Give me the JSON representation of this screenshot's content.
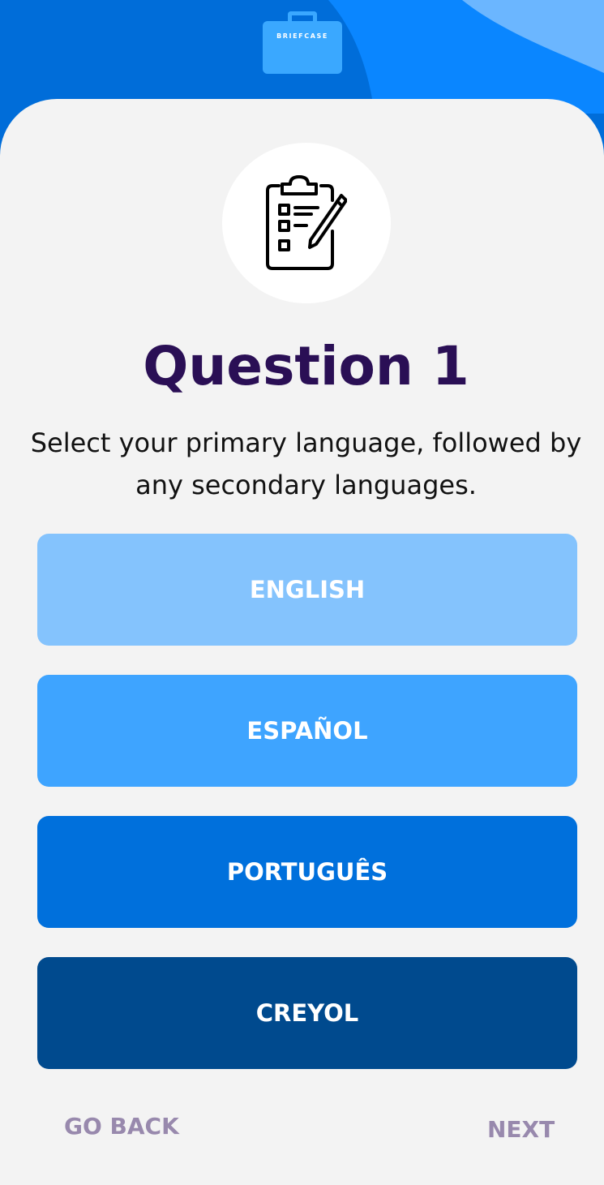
{
  "header": {
    "logo_text": "BRIEFCASE",
    "colors": {
      "dark_blue": "#006dd9",
      "mid_blue": "#0a86ff",
      "light_blue": "#6bb6ff"
    }
  },
  "icon": "clipboard-checklist-icon",
  "title": "Question 1",
  "subtitle": "Select your primary language, followed by any secondary languages.",
  "options": [
    {
      "label": "ENGLISH",
      "color": "#84c3fd"
    },
    {
      "label": "ESPAÑOL",
      "color": "#3ea4ff"
    },
    {
      "label": "PORTUGUÊS",
      "color": "#0070dc"
    },
    {
      "label": "CREYOL",
      "color": "#004a8e"
    }
  ],
  "nav": {
    "back_label": "GO BACK",
    "next_label": "NEXT"
  }
}
